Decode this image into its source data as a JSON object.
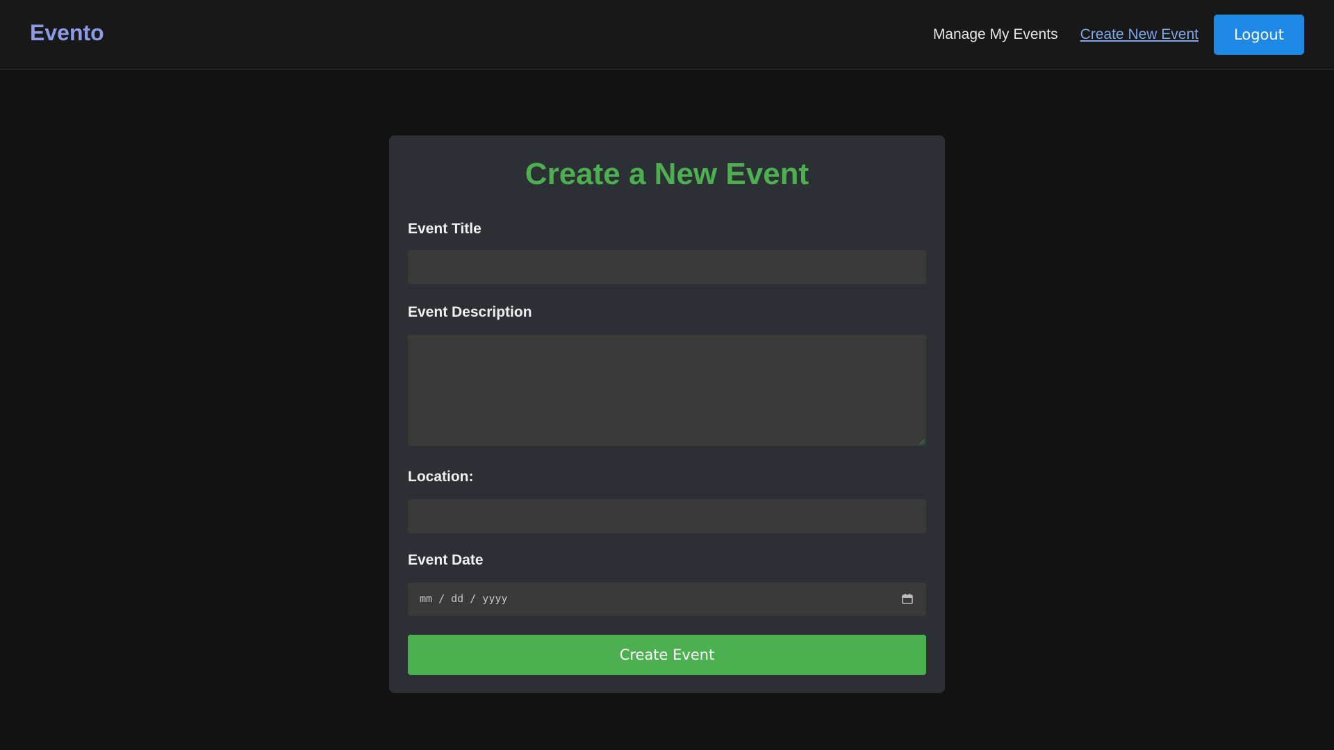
{
  "navbar": {
    "brand": "Evento",
    "links": {
      "manage": "Manage My Events",
      "create": "Create New Event"
    },
    "logout_label": "Logout"
  },
  "form": {
    "title": "Create a New Event",
    "fields": {
      "title_label": "Event Title",
      "title_value": "",
      "description_label": "Event Description",
      "description_value": "",
      "location_label": "Location:",
      "location_value": "",
      "date_label": "Event Date",
      "date_placeholder": "mm / dd / yyyy"
    },
    "submit_label": "Create Event"
  },
  "colors": {
    "brand": "#8b9be8",
    "accent_green": "#4caf50",
    "logout_blue": "#1e88e5",
    "active_link": "#7ea6e8"
  },
  "icons": {
    "date_picker": "calendar-icon"
  }
}
